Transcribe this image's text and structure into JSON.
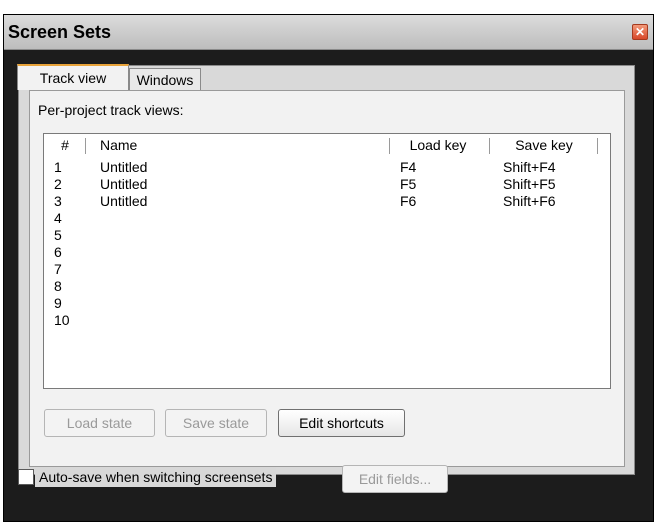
{
  "window": {
    "title": "Screen Sets",
    "close_glyph": "✕"
  },
  "tabs": [
    {
      "label": "Track view",
      "active": true
    },
    {
      "label": "Windows",
      "active": false
    }
  ],
  "track_view": {
    "caption": "Per-project track views:",
    "columns": [
      "#",
      "Name",
      "Load key",
      "Save key"
    ],
    "rows": [
      {
        "num": "1",
        "name": "Untitled",
        "load_key": "F4",
        "save_key": "Shift+F4"
      },
      {
        "num": "2",
        "name": "Untitled",
        "load_key": "F5",
        "save_key": "Shift+F5"
      },
      {
        "num": "3",
        "name": "Untitled",
        "load_key": "F6",
        "save_key": "Shift+F6"
      },
      {
        "num": "4",
        "name": "",
        "load_key": "",
        "save_key": ""
      },
      {
        "num": "5",
        "name": "",
        "load_key": "",
        "save_key": ""
      },
      {
        "num": "6",
        "name": "",
        "load_key": "",
        "save_key": ""
      },
      {
        "num": "7",
        "name": "",
        "load_key": "",
        "save_key": ""
      },
      {
        "num": "8",
        "name": "",
        "load_key": "",
        "save_key": ""
      },
      {
        "num": "9",
        "name": "",
        "load_key": "",
        "save_key": ""
      },
      {
        "num": "10",
        "name": "",
        "load_key": "",
        "save_key": ""
      }
    ],
    "buttons": {
      "load_state": "Load state",
      "save_state": "Save state",
      "edit_shortcuts": "Edit shortcuts"
    }
  },
  "footer": {
    "autosave_label": "Auto-save when switching screensets",
    "autosave_checked": false,
    "edit_fields": "Edit fields..."
  },
  "colors": {
    "active_tab_accent": "#e8a33a",
    "close_button": "#d8482a",
    "window_frame": "#1c1c1c"
  }
}
